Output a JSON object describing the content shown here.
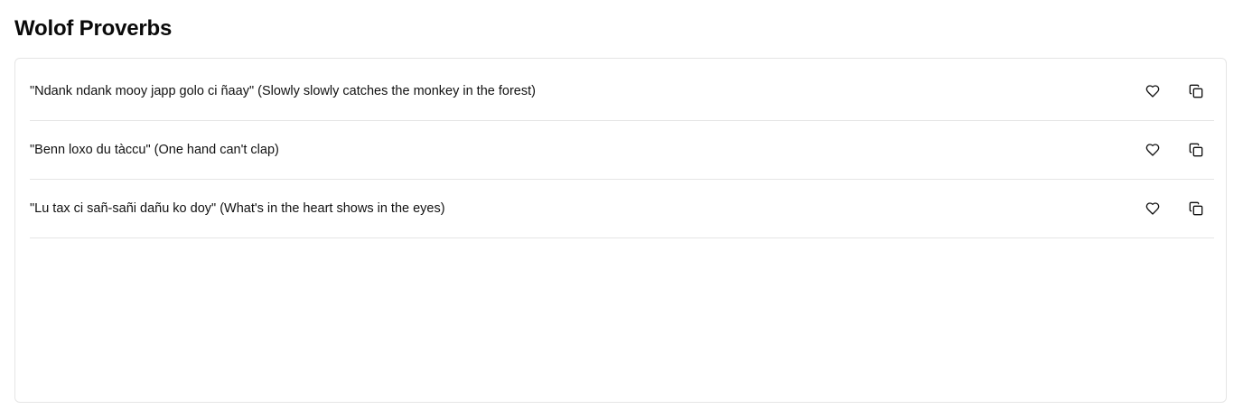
{
  "page": {
    "title": "Wolof Proverbs"
  },
  "proverbs": [
    {
      "text": "\"Ndank ndank mooy japp golo ci ñaay\" (Slowly slowly catches the monkey in the forest)",
      "favorite_icon": "heart-icon",
      "copy_icon": "copy-icon"
    },
    {
      "text": "\"Benn loxo du tàccu\" (One hand can't clap)",
      "favorite_icon": "heart-icon",
      "copy_icon": "copy-icon"
    },
    {
      "text": "\"Lu tax ci sañ-sañi dañu ko doy\" (What's in the heart shows in the eyes)",
      "favorite_icon": "heart-icon",
      "copy_icon": "copy-icon"
    }
  ],
  "colors": {
    "text": "#111111",
    "border": "#e5e5e5",
    "background": "#ffffff"
  }
}
